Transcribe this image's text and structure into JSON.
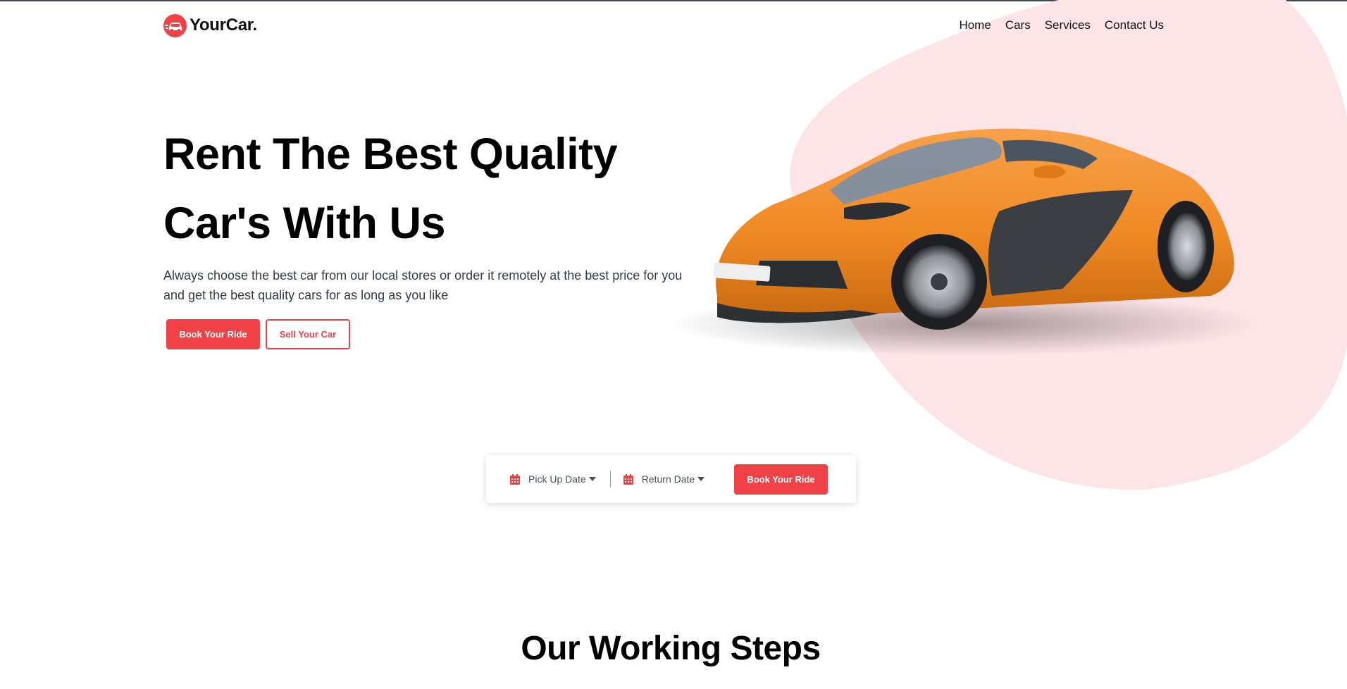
{
  "brand": {
    "name": "YourCar.",
    "icon": "car-logo-icon",
    "color": "#ef4146"
  },
  "nav": {
    "items": [
      {
        "label": "Home"
      },
      {
        "label": "Cars"
      },
      {
        "label": "Services"
      },
      {
        "label": "Contact Us"
      }
    ]
  },
  "hero": {
    "title_line1": "Rent The Best Quality",
    "title_line2": "Car's With Us",
    "description": "Always choose the best car from our local stores or order it remotely at the best price for you and get the best quality cars for as long as you like",
    "primary_button": "Book Your Ride",
    "secondary_button": "Sell Your Car",
    "image": "orange-sports-car",
    "blob_color": "#fde4e7"
  },
  "booking": {
    "pickup_label": "Pick Up Date",
    "return_label": "Return Date",
    "button_label": "Book Your Ride",
    "icon": "calendar-icon"
  },
  "sections": {
    "working_steps_title": "Our Working Steps"
  },
  "colors": {
    "accent": "#ef4146",
    "text": "#111111"
  }
}
